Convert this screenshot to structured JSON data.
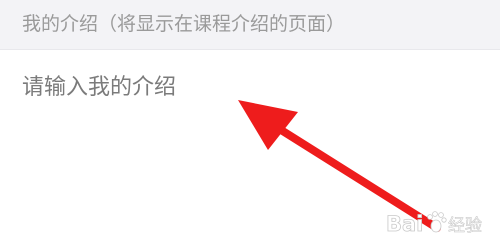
{
  "section": {
    "title": "我的介绍（将显示在课程介绍的页面）"
  },
  "intro": {
    "value": "",
    "placeholder": "请输入我的介绍"
  },
  "annotation": {
    "arrow_color": "#ee1c1c",
    "icon": "arrow-pointer"
  },
  "watermark": {
    "text": "Bai 经验",
    "icon": "paw-icon"
  }
}
